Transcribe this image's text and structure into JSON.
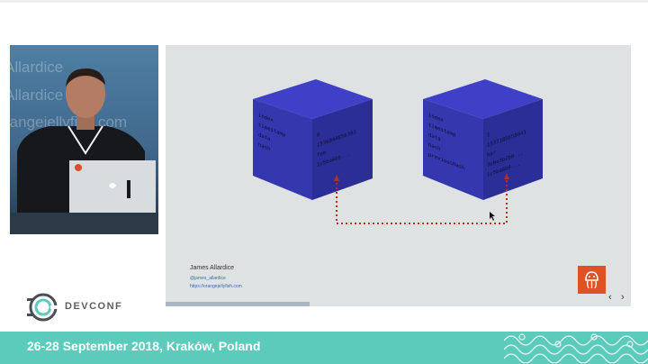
{
  "slide": {
    "block1": {
      "left_lines": [
        "index",
        "timestamp",
        "data",
        "hash"
      ],
      "right_lines": [
        "0",
        "1536844856393",
        "foo",
        "1c5ba6b6..."
      ]
    },
    "block2": {
      "left_lines": [
        "index",
        "timestamp",
        "data",
        "hash",
        "previousHash"
      ],
      "right_lines": [
        "1",
        "1537185658041",
        "bar",
        "3cbe3b2b0...",
        "1c5ba6b6..."
      ]
    },
    "speaker_name": "James Allardice",
    "speaker_handle": "@james_allardice",
    "speaker_url": "https://orangejellyfish.com",
    "badge_icon": "jellyfish-icon",
    "prev_glyph": "‹",
    "next_glyph": "›"
  },
  "camera": {
    "wall_lines": [
      "Allardice",
      "Allardice",
      "rangejellyfish.com"
    ]
  },
  "conference": {
    "logo_text": "DEVCONF",
    "date_location": "26-28 September 2018, Kraków, Poland"
  },
  "colors": {
    "accent_teal": "#5ccbbb",
    "cube_blue": "#3d3ebc",
    "badge_orange": "#de5225",
    "chain_line": "#b5301d"
  }
}
